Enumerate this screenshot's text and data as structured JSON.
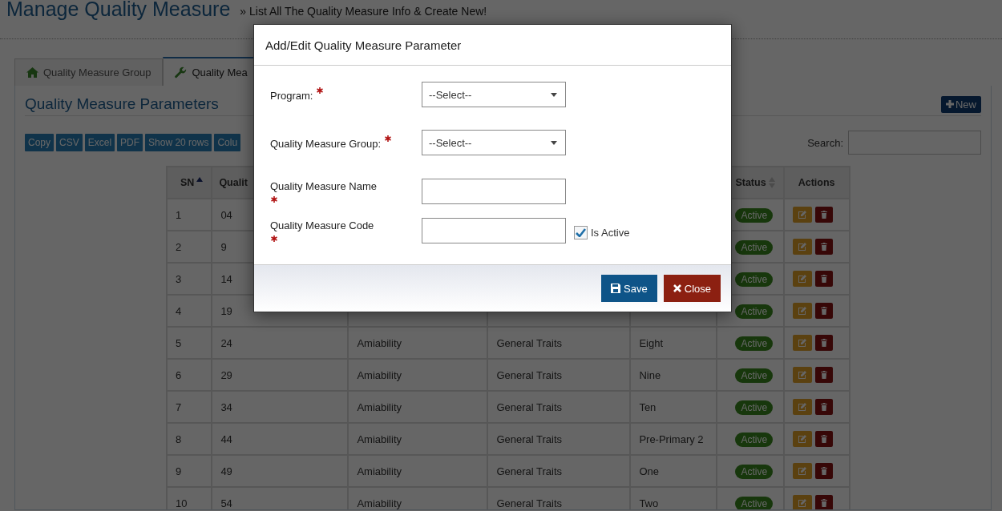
{
  "page": {
    "title": "Manage Quality Measure",
    "subtitle": "» List All The Quality Measure Info & Create New!"
  },
  "tabs": [
    {
      "label": "Quality Measure Group",
      "selected": false
    },
    {
      "label": "Quality Mea",
      "selected": true
    }
  ],
  "panel": {
    "title": "Quality Measure Parameters",
    "new_button": "New",
    "toolbar_buttons": [
      "Copy",
      "CSV",
      "Excel",
      "PDF",
      "Show 20 rows",
      "Colu"
    ],
    "search_label": "Search:"
  },
  "table": {
    "columns": [
      {
        "label": "SN",
        "sorted": true
      },
      {
        "label": "Qualit"
      },
      {
        "label": "Status",
        "sorted": false
      },
      {
        "label": "Actions"
      }
    ],
    "rows": [
      {
        "cells": [
          "1",
          "04"
        ],
        "status": "Active"
      },
      {
        "cells": [
          "2",
          "9"
        ],
        "status": "Active"
      },
      {
        "cells": [
          "3",
          "14"
        ],
        "status": "Active"
      },
      {
        "cells": [
          "4",
          "19"
        ],
        "status": "Active"
      },
      {
        "cells": [
          "5",
          "24",
          "Amiability",
          "General Traits",
          "Eight"
        ],
        "status": "Active"
      },
      {
        "cells": [
          "6",
          "29",
          "Amiability",
          "General Traits",
          "Nine"
        ],
        "status": "Active"
      },
      {
        "cells": [
          "7",
          "34",
          "Amiability",
          "General Traits",
          "Ten"
        ],
        "status": "Active"
      },
      {
        "cells": [
          "8",
          "44",
          "Amiability",
          "General Traits",
          "Pre-Primary 2"
        ],
        "status": "Active"
      },
      {
        "cells": [
          "9",
          "49",
          "Amiability",
          "General Traits",
          "One"
        ],
        "status": "Active"
      },
      {
        "cells": [
          "10",
          "54",
          "Amiability",
          "General Traits",
          "Two"
        ],
        "status": "Active"
      }
    ]
  },
  "modal": {
    "title": "Add/Edit Quality Measure Parameter",
    "fields": [
      {
        "kind": "select",
        "label": "Program:",
        "required": true,
        "value": "--Select--"
      },
      {
        "kind": "select",
        "label": "Quality Measure Group:",
        "required": true,
        "value": "--Select--"
      },
      {
        "kind": "text",
        "label": "Quality Measure Name",
        "required": true
      },
      {
        "kind": "text",
        "label": "Quality Measure Code",
        "required": true,
        "checkbox": {
          "label": "Is Active",
          "checked": true
        }
      }
    ],
    "buttons": [
      {
        "kind": "save",
        "label": "Save"
      },
      {
        "kind": "close",
        "label": "Close"
      }
    ]
  }
}
